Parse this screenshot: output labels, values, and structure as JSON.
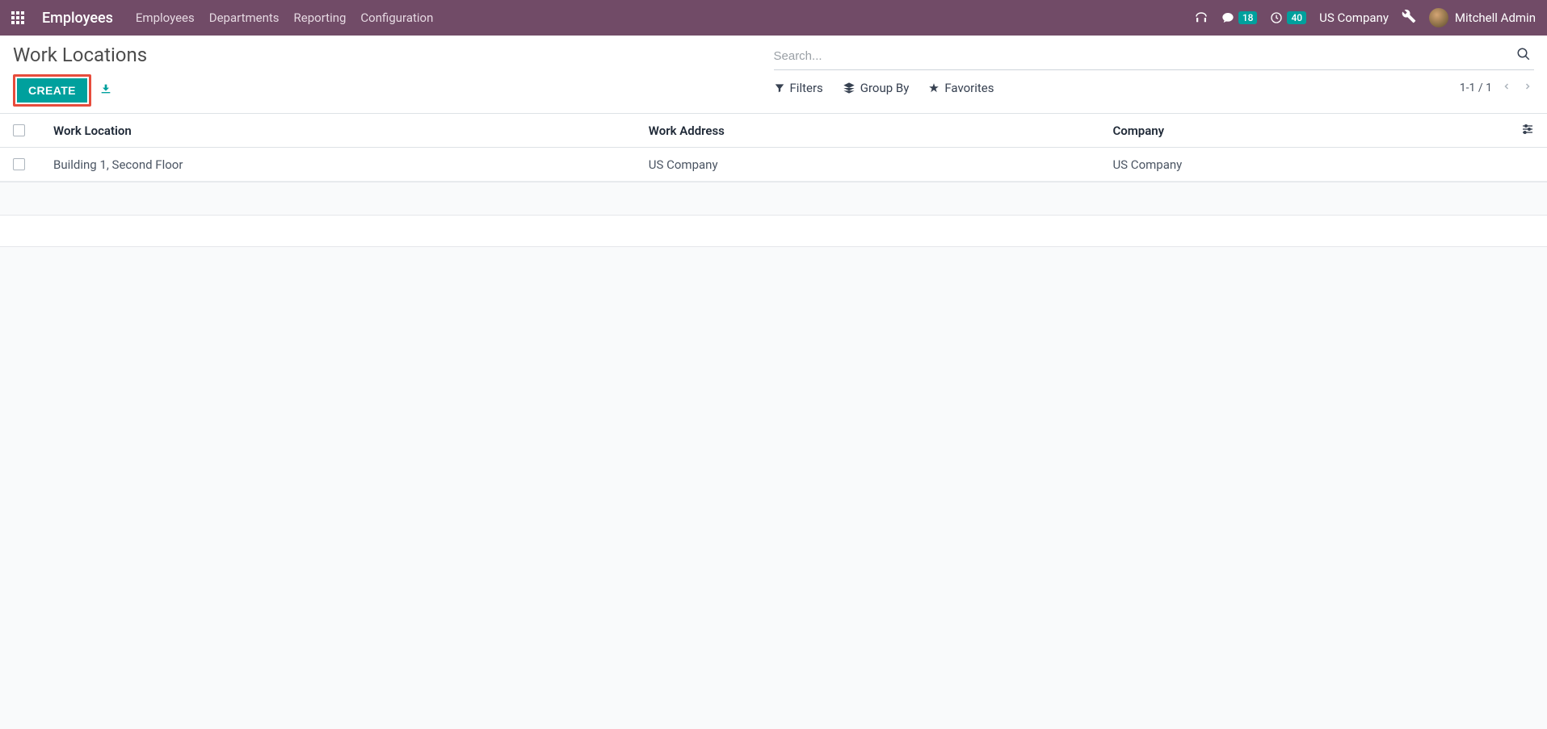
{
  "navbar": {
    "brand": "Employees",
    "links": [
      "Employees",
      "Departments",
      "Reporting",
      "Configuration"
    ],
    "messages_count": "18",
    "activities_count": "40",
    "company": "US Company",
    "user": "Mitchell Admin"
  },
  "control_panel": {
    "title": "Work Locations",
    "create_label": "CREATE",
    "search_placeholder": "Search...",
    "filters_label": "Filters",
    "group_by_label": "Group By",
    "favorites_label": "Favorites",
    "paging": "1-1 / 1"
  },
  "table": {
    "headers": {
      "work_location": "Work Location",
      "work_address": "Work Address",
      "company": "Company"
    },
    "rows": [
      {
        "work_location": "Building 1, Second Floor",
        "work_address": "US Company",
        "company": "US Company"
      }
    ]
  }
}
